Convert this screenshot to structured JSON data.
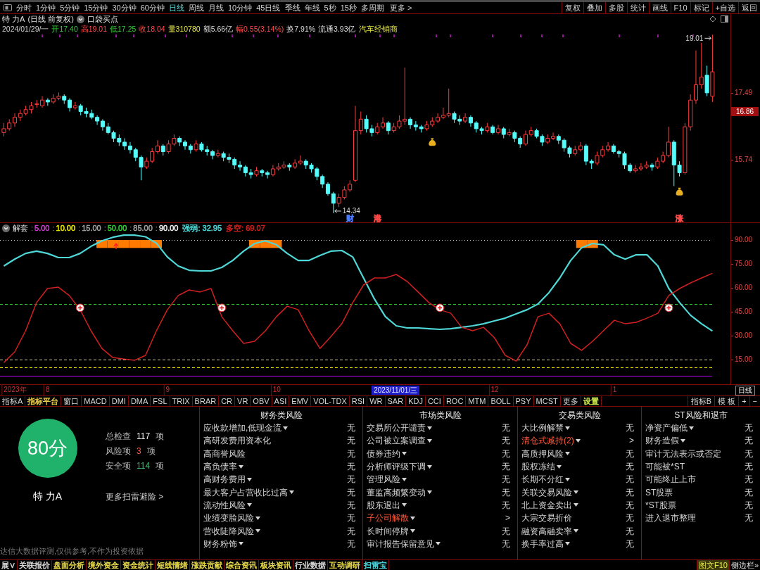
{
  "toolbar": {
    "periods": [
      {
        "label": "分时",
        "selected": false
      },
      {
        "label": "1分钟",
        "selected": false
      },
      {
        "label": "5分钟",
        "selected": false
      },
      {
        "label": "15分钟",
        "selected": false
      },
      {
        "label": "30分钟",
        "selected": false
      },
      {
        "label": "60分钟",
        "selected": false
      },
      {
        "label": "日线",
        "selected": true
      },
      {
        "label": "周线",
        "selected": false
      },
      {
        "label": "月线",
        "selected": false
      },
      {
        "label": "10分钟",
        "selected": false
      },
      {
        "label": "45日线",
        "selected": false
      },
      {
        "label": "季线",
        "selected": false
      },
      {
        "label": "年线",
        "selected": false
      },
      {
        "label": "5秒",
        "selected": false
      },
      {
        "label": "15秒",
        "selected": false
      },
      {
        "label": "多周期",
        "selected": false
      }
    ],
    "more": "更多 >",
    "actions": [
      "复权",
      "叠加",
      "多股",
      "统计",
      "画线",
      "F10",
      "标记",
      "+自选",
      "返回"
    ]
  },
  "price_panel": {
    "quote": {
      "title": "特 力A",
      "subtitle": "(日线 前复权)",
      "strategy": "口袋买点",
      "date": "2024/01/29/一",
      "fields": [
        {
          "label": "开",
          "value": "17.40",
          "kind": "down"
        },
        {
          "label": "高",
          "value": "19.01",
          "kind": "up"
        },
        {
          "label": "低",
          "value": "17.25",
          "kind": "down"
        },
        {
          "label": "收",
          "value": "18.04",
          "kind": "up"
        },
        {
          "label": "量",
          "value": "310780",
          "kind": "volume"
        },
        {
          "label": "额",
          "value": "5.66亿",
          "kind": "neutral"
        },
        {
          "label": "幅",
          "value": "0.55(3.14%)",
          "kind": "up"
        },
        {
          "label": "换",
          "value": "7.91%",
          "kind": "neutral"
        },
        {
          "label": "流通",
          "value": "3.93亿",
          "kind": "neutral"
        }
      ],
      "sector": "汽车经销商"
    },
    "event_tags": [
      {
        "label": "财",
        "color": "#4a7cff"
      },
      {
        "label": "港",
        "color": "#ff4a4a"
      },
      {
        "label": "涨",
        "color": "#ff4a4a"
      }
    ],
    "chart_data": [
      {
        "type": "candlestick",
        "ylim": [
          14.1,
          19.55
        ],
        "yticks": [
          {
            "value": 17.49,
            "label": "17.49"
          },
          {
            "value": 15.74,
            "label": "15.74"
          }
        ],
        "annotations": [
          "19.01",
          "14.34",
          "16.86"
        ],
        "ohlc": [
          [
            16.45,
            16.7,
            16.35,
            16.55
          ],
          [
            16.55,
            16.8,
            16.5,
            16.7
          ],
          [
            16.7,
            16.95,
            16.6,
            16.85
          ],
          [
            16.85,
            17.05,
            16.75,
            16.95
          ],
          [
            16.95,
            17.15,
            16.9,
            17.05
          ],
          [
            17.05,
            17.25,
            16.95,
            17.15
          ],
          [
            17.2,
            17.3,
            17.1,
            17.2
          ],
          [
            17.15,
            17.4,
            17.1,
            17.3
          ],
          [
            17.3,
            17.35,
            17.15,
            17.25
          ],
          [
            17.25,
            17.45,
            17.2,
            17.35
          ],
          [
            17.35,
            17.5,
            17.3,
            17.4
          ],
          [
            17.4,
            17.45,
            17.2,
            17.3
          ],
          [
            17.3,
            17.35,
            17.0,
            17.1
          ],
          [
            17.1,
            17.25,
            17.05,
            17.15
          ],
          [
            17.15,
            17.2,
            16.9,
            17.0
          ],
          [
            17.0,
            17.1,
            16.85,
            16.95
          ],
          [
            16.95,
            17.05,
            16.8,
            16.85
          ],
          [
            16.85,
            16.9,
            16.65,
            16.75
          ],
          [
            16.75,
            16.8,
            16.5,
            16.6
          ],
          [
            16.6,
            16.7,
            16.4,
            16.45
          ],
          [
            16.45,
            16.5,
            16.2,
            16.3
          ],
          [
            16.3,
            16.4,
            16.1,
            16.2
          ],
          [
            16.2,
            16.3,
            16.0,
            16.1
          ],
          [
            16.1,
            16.2,
            15.9,
            16.0
          ],
          [
            16.0,
            16.05,
            15.7,
            15.8
          ],
          [
            15.8,
            15.85,
            15.2,
            15.55
          ],
          [
            15.55,
            15.8,
            15.5,
            15.7
          ],
          [
            15.7,
            16.05,
            15.65,
            15.95
          ],
          [
            15.95,
            16.25,
            15.9,
            16.1
          ],
          [
            16.1,
            16.15,
            15.85,
            15.95
          ],
          [
            15.95,
            16.25,
            15.9,
            16.15
          ],
          [
            16.15,
            16.4,
            16.1,
            16.3
          ],
          [
            16.3,
            16.35,
            16.1,
            16.2
          ],
          [
            16.2,
            16.25,
            16.0,
            16.1
          ],
          [
            16.1,
            16.15,
            15.9,
            16.0
          ],
          [
            16.0,
            16.25,
            15.95,
            16.15
          ],
          [
            16.15,
            16.2,
            15.95,
            16.0
          ],
          [
            16.0,
            16.1,
            15.85,
            15.95
          ],
          [
            15.95,
            16.0,
            15.75,
            15.85
          ],
          [
            15.85,
            16.0,
            15.8,
            15.9
          ],
          [
            15.9,
            15.95,
            15.7,
            15.8
          ],
          [
            15.8,
            15.9,
            15.65,
            15.75
          ],
          [
            15.75,
            15.8,
            15.5,
            15.6
          ],
          [
            15.6,
            15.7,
            15.45,
            15.55
          ],
          [
            15.55,
            15.6,
            15.3,
            15.4
          ],
          [
            15.4,
            15.5,
            15.25,
            15.35
          ],
          [
            15.35,
            15.55,
            15.3,
            15.45
          ],
          [
            15.45,
            15.5,
            15.3,
            15.4
          ],
          [
            15.4,
            15.45,
            15.25,
            15.35
          ],
          [
            15.35,
            15.6,
            15.3,
            15.5
          ],
          [
            15.5,
            15.65,
            15.45,
            15.55
          ],
          [
            15.55,
            15.7,
            15.5,
            15.6
          ],
          [
            15.6,
            15.65,
            15.45,
            15.55
          ],
          [
            15.55,
            15.75,
            15.5,
            15.65
          ],
          [
            15.65,
            15.85,
            15.6,
            15.7
          ],
          [
            15.7,
            15.75,
            15.5,
            15.6
          ],
          [
            15.6,
            15.65,
            15.4,
            15.5
          ],
          [
            15.5,
            15.55,
            15.2,
            15.3
          ],
          [
            15.3,
            15.35,
            15.0,
            15.1
          ],
          [
            15.1,
            15.15,
            14.8,
            14.85
          ],
          [
            14.85,
            14.9,
            14.34,
            14.6
          ],
          [
            14.6,
            14.85,
            14.5,
            14.75
          ],
          [
            14.75,
            15.05,
            14.7,
            14.95
          ],
          [
            14.95,
            15.2,
            14.9,
            15.1
          ],
          [
            15.2,
            17.15,
            15.15,
            16.5
          ],
          [
            16.5,
            17.0,
            16.4,
            16.8
          ],
          [
            16.8,
            16.9,
            16.45,
            16.55
          ],
          [
            16.55,
            16.65,
            16.35,
            16.45
          ],
          [
            16.45,
            16.7,
            16.4,
            16.6
          ],
          [
            16.6,
            16.85,
            16.55,
            16.7
          ],
          [
            16.7,
            16.75,
            16.4,
            16.5
          ],
          [
            16.5,
            16.7,
            16.45,
            16.6
          ],
          [
            16.6,
            16.9,
            16.55,
            16.75
          ],
          [
            16.75,
            18.15,
            16.65,
            16.8
          ],
          [
            16.8,
            16.85,
            16.55,
            16.65
          ],
          [
            16.65,
            16.75,
            16.5,
            16.6
          ],
          [
            16.6,
            16.65,
            16.45,
            16.55
          ],
          [
            16.55,
            16.75,
            16.5,
            16.65
          ],
          [
            16.65,
            16.85,
            16.6,
            16.75
          ],
          [
            16.75,
            16.95,
            16.7,
            16.85
          ],
          [
            16.85,
            17.1,
            16.8,
            16.9
          ],
          [
            16.9,
            17.6,
            16.85,
            16.95
          ],
          [
            16.95,
            17.0,
            16.7,
            16.8
          ],
          [
            16.8,
            16.9,
            16.65,
            16.75
          ],
          [
            16.75,
            16.95,
            16.7,
            16.85
          ],
          [
            16.85,
            16.9,
            16.6,
            16.7
          ],
          [
            16.7,
            16.75,
            16.45,
            16.55
          ],
          [
            16.55,
            16.6,
            16.4,
            16.5
          ],
          [
            16.5,
            16.7,
            16.45,
            16.6
          ],
          [
            16.6,
            16.65,
            16.4,
            16.45
          ],
          [
            16.45,
            16.65,
            16.4,
            16.55
          ],
          [
            16.55,
            16.6,
            16.3,
            16.4
          ],
          [
            16.4,
            16.55,
            16.35,
            16.45
          ],
          [
            16.45,
            16.5,
            16.2,
            16.3
          ],
          [
            16.3,
            16.35,
            16.05,
            16.15
          ],
          [
            16.15,
            16.5,
            16.1,
            16.4
          ],
          [
            16.4,
            16.6,
            16.35,
            16.5
          ],
          [
            16.5,
            16.55,
            16.3,
            16.35
          ],
          [
            16.35,
            16.4,
            16.1,
            16.2
          ],
          [
            16.2,
            16.4,
            16.15,
            16.3
          ],
          [
            16.3,
            16.45,
            16.25,
            16.35
          ],
          [
            16.35,
            16.4,
            16.15,
            16.25
          ],
          [
            16.25,
            16.3,
            15.95,
            16.05
          ],
          [
            16.05,
            16.1,
            15.8,
            15.9
          ],
          [
            15.9,
            16.1,
            15.85,
            16.0
          ],
          [
            16.0,
            16.2,
            15.95,
            16.1
          ],
          [
            16.1,
            16.15,
            15.6,
            15.7
          ],
          [
            15.7,
            15.75,
            15.5,
            15.65
          ],
          [
            15.65,
            15.95,
            15.6,
            15.85
          ],
          [
            15.85,
            16.1,
            15.8,
            16.0
          ],
          [
            16.0,
            16.2,
            15.95,
            16.1
          ],
          [
            16.1,
            16.15,
            15.9,
            15.95
          ],
          [
            15.95,
            16.0,
            15.8,
            15.9
          ],
          [
            15.9,
            15.95,
            15.5,
            15.6
          ],
          [
            15.6,
            15.65,
            15.4,
            15.45
          ],
          [
            15.45,
            15.6,
            15.4,
            15.5
          ],
          [
            15.5,
            15.65,
            15.45,
            15.55
          ],
          [
            15.55,
            15.7,
            15.5,
            15.6
          ],
          [
            15.6,
            15.65,
            15.45,
            15.55
          ],
          [
            15.55,
            15.8,
            15.5,
            15.7
          ],
          [
            15.7,
            15.95,
            15.65,
            15.85
          ],
          [
            15.85,
            16.6,
            15.8,
            16.2
          ],
          [
            16.2,
            16.25,
            15.05,
            15.6
          ],
          [
            15.6,
            15.7,
            15.3,
            15.4
          ],
          [
            15.4,
            16.7,
            15.35,
            16.6
          ],
          [
            16.6,
            17.45,
            16.5,
            17.3
          ],
          [
            17.3,
            18.6,
            17.2,
            17.7
          ],
          [
            17.7,
            18.8,
            17.6,
            17.9
          ],
          [
            17.95,
            18.2,
            17.4,
            17.49
          ],
          [
            17.4,
            19.01,
            17.25,
            18.04
          ]
        ]
      }
    ]
  },
  "indicator_panel": {
    "title": "解套",
    "separator": ":",
    "params": [
      {
        "text": "5.00",
        "color": "#d040d0"
      },
      {
        "text": "10.00",
        "color": "#e8e800"
      },
      {
        "text": "15.00",
        "color": "#a0a0a0"
      },
      {
        "text": "50.00",
        "color": "#30d030"
      },
      {
        "text": "85.00",
        "color": "#a0a0a0"
      },
      {
        "text": "90.00",
        "color": "#f0f0f0"
      }
    ],
    "readings": [
      {
        "label": "强弱",
        "value": "32.95",
        "color": "#4fd8d8"
      },
      {
        "label": "多空",
        "value": "69.07",
        "color": "#d02020"
      }
    ],
    "chart_data": [
      {
        "type": "line",
        "ylim": [
          -0.4,
          100.6
        ],
        "yticks": [
          {
            "value": 90,
            "label": "90.00"
          },
          {
            "value": 75,
            "label": "75.00"
          },
          {
            "value": 60,
            "label": "60.00"
          },
          {
            "value": 45,
            "label": "45.00"
          },
          {
            "value": 30,
            "label": "30.00"
          },
          {
            "value": 15,
            "label": "15.00"
          }
        ],
        "categories": [
          null,
          "2023年",
          null,
          null,
          "8",
          null,
          null,
          null,
          null,
          null,
          null,
          null,
          null,
          null,
          null,
          "9",
          null,
          null,
          null,
          null,
          null,
          null,
          null,
          null,
          null,
          "10",
          null,
          null,
          null,
          null,
          null,
          null,
          null,
          null,
          null,
          null,
          null,
          null,
          null,
          null,
          null,
          null,
          null,
          null,
          null,
          "12",
          null,
          null,
          null,
          null,
          null,
          null,
          null,
          null,
          null,
          null,
          "1",
          null,
          null,
          null,
          null,
          null,
          null,
          null,
          null,
          null
        ],
        "annotations": [
          "2023/11/01/三"
        ],
        "ref_lines": [
          {
            "axis": "y",
            "value": 90,
            "color": "#d0d0d0",
            "line_style": "dotted"
          },
          {
            "axis": "y",
            "value": 50,
            "color": "#30c030",
            "line_style": "dashed"
          },
          {
            "axis": "y",
            "value": 15,
            "color": "#d8d8a0",
            "line_style": "dashed"
          },
          {
            "axis": "y",
            "value": 10,
            "color": "#e8d800",
            "line_style": "dashed"
          },
          {
            "axis": "y",
            "value": 5,
            "color": "#b400ff",
            "line_style": "solid"
          }
        ],
        "series": [
          {
            "color": "#4fd8d8",
            "values": [
              73.7,
              78,
              81.6,
              83,
              81.6,
              79,
              79,
              81.6,
              86,
              89.5,
              91.7,
              93,
              93,
              92,
              88,
              79.4,
              73.7,
              71,
              70.6,
              70.6,
              72.8,
              77.2,
              83,
              87.8,
              89.5,
              87,
              81.6,
              77.2,
              77.2,
              80.3,
              83,
              83.4,
              79.4,
              66.2,
              53,
              42,
              36.2,
              34.9,
              34.9,
              34.4,
              34,
              34.4,
              35.3,
              36.2,
              37.5,
              39.3,
              41,
              43.7,
              46.3,
              49.9,
              57,
              66.2,
              77.2,
              85.1,
              87.8,
              87,
              80.7,
              78,
              80.7,
              80.7,
              73.7,
              59.6,
              50.7,
              42.8,
              37.5,
              33
            ]
          },
          {
            "color": "#d02020",
            "values": [
              13.2,
              19.9,
              33.1,
              50.7,
              59.6,
              60.4,
              55.2,
              46.3,
              33.1,
              22,
              16.3,
              15.4,
              14.6,
              17.7,
              33.1,
              46.3,
              55.2,
              58.7,
              57.4,
              59.6,
              41.9,
              33.1,
              25.2,
              26.5,
              33.1,
              41.9,
              48.5,
              46.3,
              33.1,
              22,
              29.5,
              37.5,
              50.7,
              61.8,
              66.2,
              66.2,
              68.4,
              64,
              57.4,
              50.7,
              46.3,
              44.1,
              35.3,
              33.1,
              35.3,
              28.7,
              17.7,
              14.1,
              24.3,
              41.9,
              44.1,
              37.5,
              25.2,
              20.8,
              26.5,
              33.1,
              39.7,
              37.5,
              38.4,
              41,
              44.1,
              55.2,
              59.6,
              63.1,
              66.2,
              69.1
            ]
          },
          {
            "type": "bar",
            "color": "#ff7a00",
            "base": [
              null,
              null,
              null,
              null,
              null,
              null,
              null,
              null,
              null,
              85,
              85,
              85,
              85,
              85,
              85,
              null,
              null,
              null,
              null,
              null,
              null,
              null,
              null,
              85,
              85,
              85,
              null,
              null,
              null,
              null,
              null,
              null,
              null,
              null,
              null,
              null,
              null,
              null,
              null,
              null,
              null,
              null,
              null,
              null,
              null,
              null,
              null,
              null,
              null,
              null,
              null,
              null,
              null,
              85,
              85,
              null,
              null,
              null,
              null,
              null,
              null,
              null,
              null,
              null,
              null,
              null
            ],
            "values": [
              null,
              null,
              null,
              null,
              null,
              null,
              null,
              null,
              null,
              5,
              5,
              5,
              5,
              5,
              5,
              null,
              null,
              null,
              null,
              null,
              null,
              null,
              null,
              5,
              5,
              5,
              null,
              null,
              null,
              null,
              null,
              null,
              null,
              null,
              null,
              null,
              null,
              null,
              null,
              null,
              null,
              null,
              null,
              null,
              null,
              null,
              null,
              null,
              null,
              null,
              null,
              null,
              null,
              5,
              5,
              null,
              null,
              null,
              null,
              null,
              null,
              null,
              null,
              null,
              null,
              null
            ]
          },
          {
            "type": "scatter",
            "marker": "plus-circle",
            "values": [
              null,
              null,
              null,
              null,
              null,
              null,
              null,
              47.5,
              null,
              null,
              null,
              null,
              null,
              null,
              null,
              null,
              null,
              null,
              null,
              null,
              47.5,
              null,
              null,
              null,
              null,
              null,
              null,
              null,
              null,
              null,
              null,
              null,
              null,
              null,
              null,
              null,
              null,
              null,
              null,
              null,
              47.5,
              null,
              null,
              null,
              null,
              null,
              null,
              null,
              null,
              null,
              null,
              null,
              null,
              null,
              null,
              null,
              null,
              null,
              null,
              null,
              null,
              47.5,
              null,
              null,
              null,
              null
            ]
          }
        ]
      }
    ]
  },
  "time_axis_period": "日线",
  "indicator_tabs": {
    "left": [
      {
        "label": "指标A"
      },
      {
        "label": "指标平台",
        "color": "#e6c84a"
      },
      {
        "label": "窗口"
      },
      {
        "label": "MACD"
      },
      {
        "label": "DMI"
      },
      {
        "label": "DMA"
      },
      {
        "label": "FSL"
      },
      {
        "label": "TRIX"
      },
      {
        "label": "BRAR"
      },
      {
        "label": "CR"
      },
      {
        "label": "VR"
      },
      {
        "label": "OBV"
      },
      {
        "label": "ASI"
      },
      {
        "label": "EMV"
      },
      {
        "label": "VOL-TDX"
      },
      {
        "label": "RSI"
      },
      {
        "label": "WR"
      },
      {
        "label": "SAR"
      },
      {
        "label": "KDJ"
      },
      {
        "label": "CCI"
      },
      {
        "label": "ROC"
      },
      {
        "label": "MTM"
      },
      {
        "label": "BOLL"
      },
      {
        "label": "PSY"
      },
      {
        "label": "MCST"
      },
      {
        "label": "更多"
      },
      {
        "label": "设置",
        "color": "#c8e64a"
      }
    ],
    "right": [
      {
        "label": "指标B"
      },
      {
        "label": "模 板"
      },
      {
        "label": "+"
      },
      {
        "label": "−"
      }
    ]
  },
  "scan": {
    "score": "80分",
    "stock": "特 力A",
    "stats": [
      {
        "label": "总检查",
        "value": "117",
        "unit": "项",
        "kind": "total"
      },
      {
        "label": "风险项",
        "value": "3",
        "unit": "项",
        "kind": "risk"
      },
      {
        "label": "安全项",
        "value": "114",
        "unit": "项",
        "kind": "safe"
      }
    ],
    "more_link": "更多扫雷避险 >",
    "disclaimer": "达信大数据评测,仅供参考,不作为投资依据",
    "groups": [
      {
        "title": "财务类风险",
        "items": [
          {
            "label": "应收款增加,低现金流",
            "dropdown": true,
            "flagged": false,
            "status": "无"
          },
          {
            "label": "高研发费用资本化",
            "dropdown": false,
            "flagged": false,
            "status": "无"
          },
          {
            "label": "高商誉风险",
            "dropdown": false,
            "flagged": false,
            "status": "无"
          },
          {
            "label": "高负债率",
            "dropdown": true,
            "flagged": false,
            "status": "无"
          },
          {
            "label": "高财务费用",
            "dropdown": true,
            "flagged": false,
            "status": "无"
          },
          {
            "label": "最大客户占营收比过高",
            "dropdown": true,
            "flagged": false,
            "status": "无"
          },
          {
            "label": "流动性风险",
            "dropdown": true,
            "flagged": false,
            "status": "无"
          },
          {
            "label": "业绩变脸风险",
            "dropdown": true,
            "flagged": false,
            "status": "无"
          },
          {
            "label": "营收陡降风险",
            "dropdown": true,
            "flagged": false,
            "status": "无"
          },
          {
            "label": "财务粉饰",
            "dropdown": true,
            "flagged": false,
            "status": "无"
          }
        ]
      },
      {
        "title": "市场类风险",
        "items": [
          {
            "label": "交易所公开谴责",
            "dropdown": true,
            "flagged": false,
            "status": "无"
          },
          {
            "label": "公司被立案调查",
            "dropdown": true,
            "flagged": false,
            "status": "无"
          },
          {
            "label": "债券违约",
            "dropdown": true,
            "flagged": false,
            "status": "无"
          },
          {
            "label": "分析师评级下调",
            "dropdown": true,
            "flagged": false,
            "status": "无"
          },
          {
            "label": "管理风险",
            "dropdown": true,
            "flagged": false,
            "status": "无"
          },
          {
            "label": "董监高频繁变动",
            "dropdown": true,
            "flagged": false,
            "status": "无"
          },
          {
            "label": "股东退出",
            "dropdown": true,
            "flagged": false,
            "status": "无"
          },
          {
            "label": "子公司解散",
            "dropdown": true,
            "flagged": true,
            "status": ">"
          },
          {
            "label": "长时间停牌",
            "dropdown": true,
            "flagged": false,
            "status": "无"
          },
          {
            "label": "审计报告保留意见",
            "dropdown": true,
            "flagged": false,
            "status": "无"
          }
        ]
      },
      {
        "title": "交易类风险",
        "items": [
          {
            "label": "大比例解禁",
            "dropdown": true,
            "flagged": false,
            "status": "无"
          },
          {
            "label": "清仓式减持(2)",
            "dropdown": true,
            "flagged": true,
            "status": ">"
          },
          {
            "label": "高质押风险",
            "dropdown": true,
            "flagged": false,
            "status": "无"
          },
          {
            "label": "股权冻结",
            "dropdown": true,
            "flagged": false,
            "status": "无"
          },
          {
            "label": "长期不分红",
            "dropdown": true,
            "flagged": false,
            "status": "无"
          },
          {
            "label": "关联交易风险",
            "dropdown": true,
            "flagged": false,
            "status": "无"
          },
          {
            "label": "北上资金卖出",
            "dropdown": true,
            "flagged": false,
            "status": "无"
          },
          {
            "label": "大宗交易折价",
            "dropdown": false,
            "flagged": false,
            "status": "无"
          },
          {
            "label": "融资高融卖率",
            "dropdown": true,
            "flagged": false,
            "status": "无"
          },
          {
            "label": "换手率过高",
            "dropdown": true,
            "flagged": false,
            "status": "无"
          }
        ]
      },
      {
        "title": "ST风险和退市",
        "items": [
          {
            "label": "净资产偏低",
            "dropdown": true,
            "flagged": false,
            "status": "无"
          },
          {
            "label": "财务造假",
            "dropdown": true,
            "flagged": false,
            "status": "无"
          },
          {
            "label": "审计无法表示或否定",
            "dropdown": false,
            "flagged": false,
            "status": "无"
          },
          {
            "label": "可能被*ST",
            "dropdown": false,
            "flagged": false,
            "status": "无"
          },
          {
            "label": "可能终止上市",
            "dropdown": false,
            "flagged": false,
            "status": "无"
          },
          {
            "label": "ST股票",
            "dropdown": false,
            "flagged": false,
            "status": "无"
          },
          {
            "label": "*ST股票",
            "dropdown": false,
            "flagged": false,
            "status": "无"
          },
          {
            "label": "进入退市整理",
            "dropdown": false,
            "flagged": false,
            "status": "无"
          }
        ]
      }
    ]
  },
  "bottom_tabs": {
    "items": [
      {
        "label": "展∨",
        "selected": false,
        "color": "#d8d8d8"
      },
      {
        "label": "关联报价",
        "selected": false,
        "color": "#d8d8d8"
      },
      {
        "label": "盘面分析",
        "selected": false,
        "color": "#e6d84a"
      },
      {
        "label": "境外资金",
        "selected": false,
        "color": "#e6d84a"
      },
      {
        "label": "资金统计",
        "selected": false,
        "color": "#e6d84a"
      },
      {
        "label": "短线情绪",
        "selected": false,
        "color": "#e6d84a"
      },
      {
        "label": "涨跌贡献",
        "selected": false,
        "color": "#e6d84a"
      },
      {
        "label": "综合资讯",
        "selected": false,
        "color": "#e6d84a"
      },
      {
        "label": "板块资讯",
        "selected": false,
        "color": "#e6d84a"
      },
      {
        "label": "行业数据",
        "selected": false,
        "color": "#d8d8d8"
      },
      {
        "label": "互动调研",
        "selected": false,
        "color": "#e6d84a"
      },
      {
        "label": "扫雷宝",
        "selected": true
      }
    ],
    "right": [
      {
        "label": "图文F10",
        "kind": "highlight"
      },
      {
        "label": "侧边栏»",
        "kind": "plain"
      }
    ]
  }
}
